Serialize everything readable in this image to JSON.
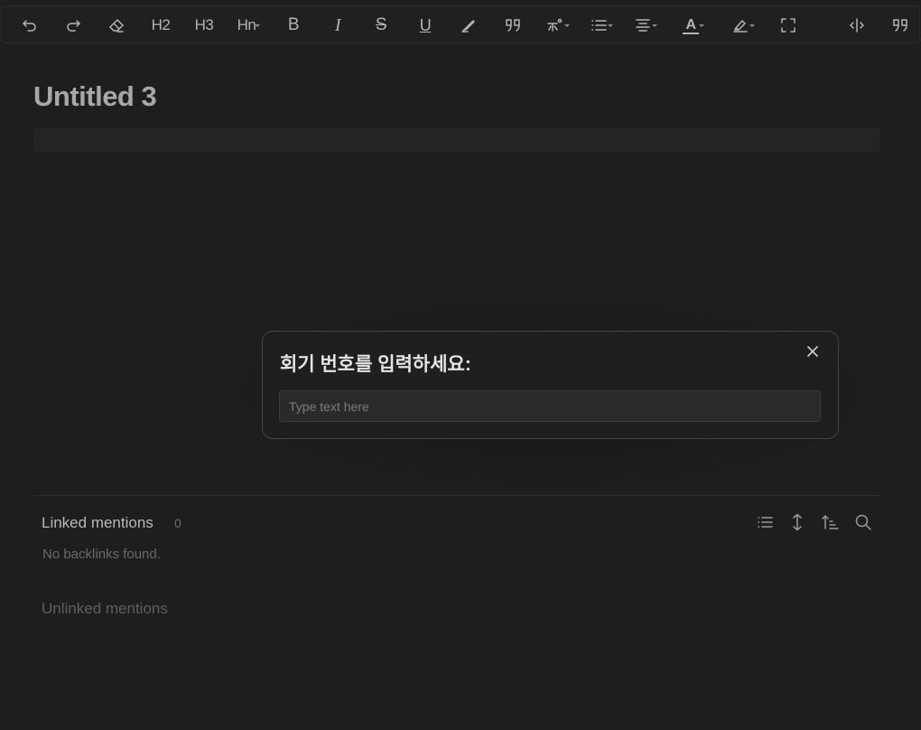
{
  "toolbar": {
    "items": [
      {
        "name": "undo-button",
        "icon": "undo-icon"
      },
      {
        "name": "redo-button",
        "icon": "redo-icon"
      },
      {
        "name": "clear-format-button",
        "icon": "eraser-icon"
      },
      {
        "name": "heading-2-button",
        "label": "H2"
      },
      {
        "name": "heading-3-button",
        "label": "H3"
      },
      {
        "name": "heading-n-button",
        "label": "Hn"
      },
      {
        "name": "bold-button",
        "label": "B"
      },
      {
        "name": "italic-button",
        "label": "I"
      },
      {
        "name": "strikethrough-button",
        "label": "S"
      },
      {
        "name": "underline-button",
        "label": "U"
      },
      {
        "name": "highlight-pen-button",
        "icon": "pen-icon"
      },
      {
        "name": "quote-button",
        "icon": "quote-icon"
      },
      {
        "name": "ruby-button",
        "icon": "ruby-icon"
      },
      {
        "name": "list-button",
        "icon": "list-icon"
      },
      {
        "name": "align-button",
        "icon": "align-center-icon"
      },
      {
        "name": "text-color-button",
        "label": "A",
        "accent": "#b4b4b4"
      },
      {
        "name": "highlight-color-button",
        "icon": "highlighter-icon"
      },
      {
        "name": "fullscreen-button",
        "icon": "fullscreen-icon"
      },
      {
        "name": "split-view-button",
        "icon": "split-icon"
      },
      {
        "name": "quote-alt-button",
        "icon": "quote-icon"
      }
    ]
  },
  "note": {
    "title": "Untitled 3"
  },
  "backlinks": {
    "linked_title": "Linked mentions",
    "linked_count": "0",
    "empty_text": "No backlinks found.",
    "unlinked_title": "Unlinked mentions",
    "icons": [
      "list-icon",
      "expand-vertical-icon",
      "sort-icon",
      "search-icon"
    ]
  },
  "modal": {
    "title": "회기 번호를 입력하세요:",
    "input_value": "",
    "input_placeholder": "Type text here"
  },
  "colors": {
    "background": "#1e1e1e",
    "toolbar_bg": "#202020",
    "modal_border": "#454545",
    "text_muted": "#6a6a6a"
  }
}
